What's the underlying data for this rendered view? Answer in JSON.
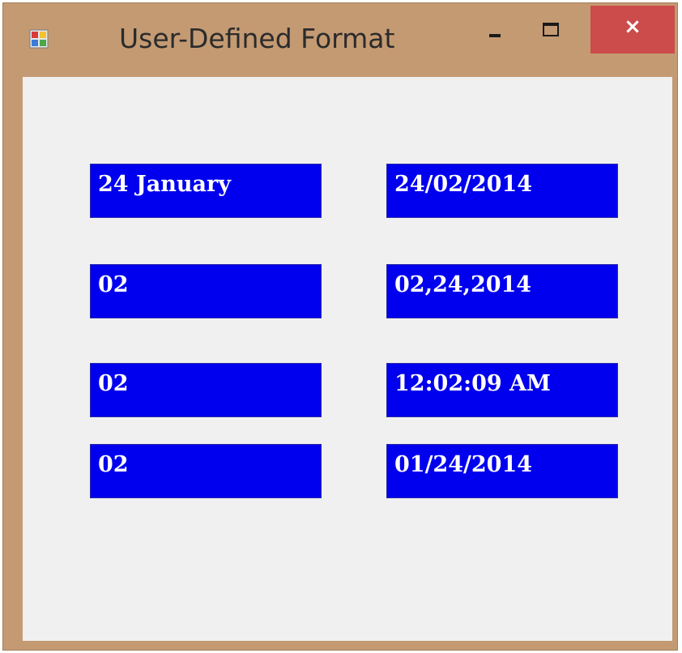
{
  "window": {
    "title": "User-Defined Format",
    "controls": {
      "close_glyph": "×"
    }
  },
  "fields": {
    "left": [
      "24 January",
      "02",
      "02",
      "02"
    ],
    "right": [
      "24/02/2014",
      "02,24,2014",
      "12:02:09 AM",
      "01/24/2014"
    ]
  },
  "colors": {
    "field_background": "#0000ee",
    "field_text": "#ffffff",
    "form_background": "#f0f0f0",
    "frame": "#c49a73",
    "close_button": "#cc4b4b"
  },
  "icons": {
    "app": "form-app-icon",
    "minimize": "minimize-icon",
    "maximize": "maximize-icon",
    "close": "close-icon"
  }
}
